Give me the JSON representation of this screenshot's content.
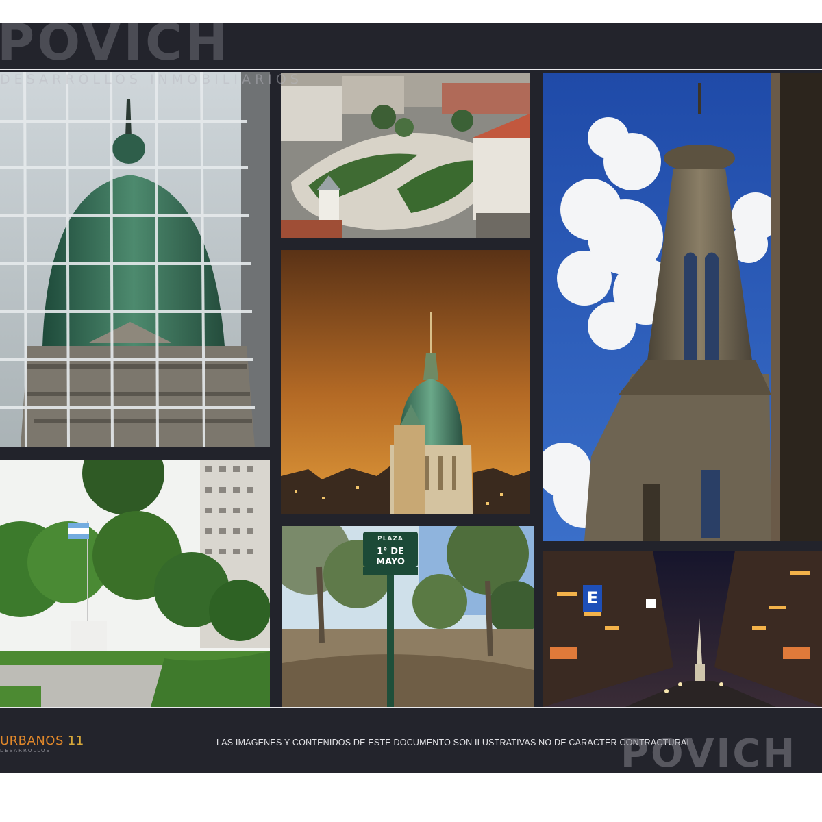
{
  "header": {
    "brand_logo": "POVICH",
    "brand_subtitle": "DESARROLLOS INMOBILIARIOS"
  },
  "footer": {
    "project_name": "URBANOS",
    "page_number": "11",
    "project_subtitle": "DESARROLLOS",
    "disclaimer": "LAS IMAGENES Y CONTENIDOS DE ESTE DOCUMENTO SON ILUSTRATIVAS NO DE CARACTER CONTRACTURAL",
    "brand_logo_right": "POVICH"
  },
  "photos": {
    "plaza_sign": {
      "line1": "PLAZA",
      "line2": "1° DE MAYO"
    },
    "street_sign": "E"
  },
  "colors": {
    "band": "#23242c",
    "accent_orange": "#e0872a",
    "sky_blue": "#2b57b8",
    "dome_green": "#3f7f62"
  }
}
